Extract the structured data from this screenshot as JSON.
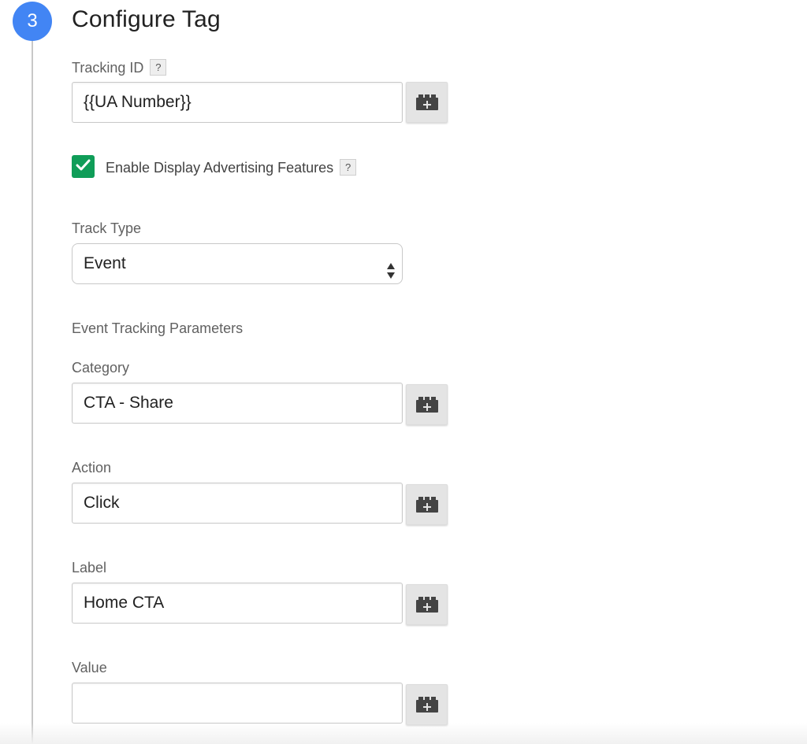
{
  "step": {
    "number": "3",
    "title": "Configure Tag"
  },
  "tracking_id": {
    "label": "Tracking ID",
    "help": "?",
    "value": "{{UA Number}}"
  },
  "display_advertising": {
    "checked": true,
    "label": "Enable Display Advertising Features",
    "help": "?"
  },
  "track_type": {
    "label": "Track Type",
    "selected": "Event"
  },
  "event_params": {
    "heading": "Event Tracking Parameters",
    "category": {
      "label": "Category",
      "value": "CTA - Share"
    },
    "action": {
      "label": "Action",
      "value": "Click"
    },
    "label": {
      "label": "Label",
      "value": "Home CTA"
    },
    "value": {
      "label": "Value",
      "value": ""
    }
  },
  "colors": {
    "step_badge": "#4285f4",
    "checkbox": "#0f9d58",
    "variable_icon": "#444444"
  },
  "icons": {
    "variable_button": "add-variable-brick-icon",
    "checkbox": "checkmark-icon",
    "select": "up-down-arrows-icon"
  }
}
